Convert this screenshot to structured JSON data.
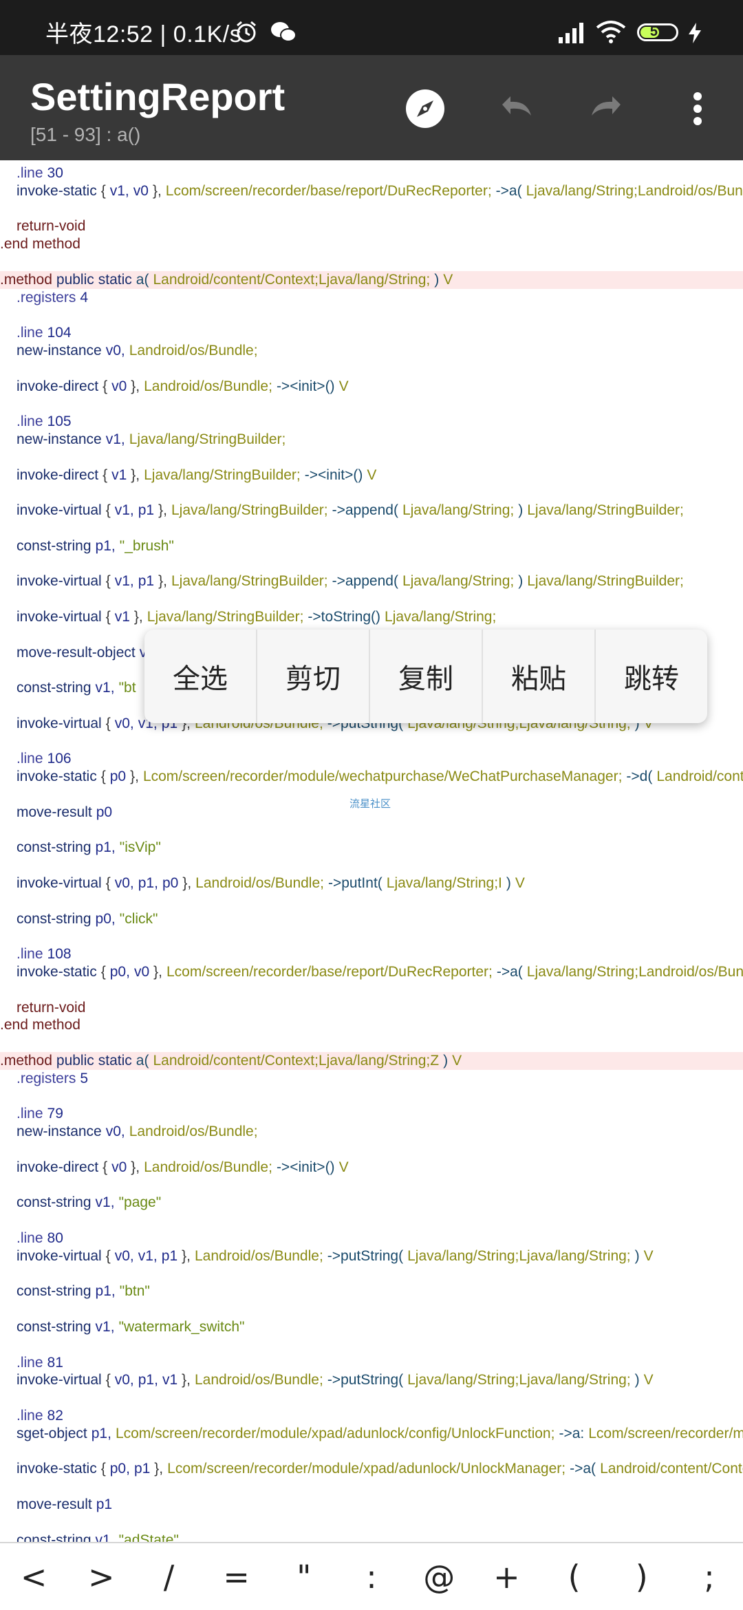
{
  "status_bar": {
    "time": "半夜12:52 | 0.1K/s",
    "battery_level": "57",
    "battery_fraction": 0.57,
    "icons": [
      "alarm-icon",
      "wechat-icon",
      "signal-icon",
      "wifi-icon",
      "battery-icon",
      "charging-icon"
    ]
  },
  "app_bar": {
    "title": "SettingReport",
    "subtitle": "[51 - 93] : a()",
    "actions": [
      "compass-icon",
      "undo-icon",
      "redo-icon",
      "more-vert-icon"
    ]
  },
  "code_lines": [
    [
      [
        "c-dir",
        "    .line"
      ],
      [
        "c-num",
        "30"
      ]
    ],
    [
      [
        "c-kw2",
        "    invoke-static"
      ],
      [
        "c-punc",
        "{"
      ],
      [
        "c-reg",
        "v1,"
      ],
      [
        "c-reg",
        "v0"
      ],
      [
        "c-punc",
        "},"
      ],
      [
        "c-type",
        "Lcom/screen/recorder/base/report/DuRecReporter;"
      ],
      [
        "c-meth",
        "->a("
      ],
      [
        "c-type",
        "Ljava/lang/String;Landroid/os/Bundle;"
      ]
    ],
    [],
    [
      [
        "c-kw",
        "    return-void"
      ]
    ],
    [
      [
        "c-kw",
        ".end"
      ],
      [
        "c-kw",
        "method"
      ]
    ],
    [],
    [
      [
        "c-kw",
        ".method"
      ],
      [
        "c-kw2",
        "public"
      ],
      [
        "c-kw2",
        "static"
      ],
      [
        "c-meth",
        "a("
      ],
      [
        "c-type",
        "Landroid/content/Context;Ljava/lang/String;"
      ],
      [
        "c-meth",
        ")"
      ],
      [
        "c-type",
        "V"
      ]
    ],
    [
      [
        "c-dir",
        "    .registers"
      ],
      [
        "c-num",
        "4"
      ]
    ],
    [],
    [
      [
        "c-dir",
        "    .line"
      ],
      [
        "c-num",
        "104"
      ]
    ],
    [
      [
        "c-kw2",
        "    new-instance"
      ],
      [
        "c-reg",
        "v0,"
      ],
      [
        "c-type",
        "Landroid/os/Bundle;"
      ]
    ],
    [],
    [
      [
        "c-kw2",
        "    invoke-direct"
      ],
      [
        "c-punc",
        "{"
      ],
      [
        "c-reg",
        "v0"
      ],
      [
        "c-punc",
        "},"
      ],
      [
        "c-type",
        "Landroid/os/Bundle;"
      ],
      [
        "c-meth",
        "-><init>()"
      ],
      [
        "c-type",
        "V"
      ]
    ],
    [],
    [
      [
        "c-dir",
        "    .line"
      ],
      [
        "c-num",
        "105"
      ]
    ],
    [
      [
        "c-kw2",
        "    new-instance"
      ],
      [
        "c-reg",
        "v1,"
      ],
      [
        "c-type",
        "Ljava/lang/StringBuilder;"
      ]
    ],
    [],
    [
      [
        "c-kw2",
        "    invoke-direct"
      ],
      [
        "c-punc",
        "{"
      ],
      [
        "c-reg",
        "v1"
      ],
      [
        "c-punc",
        "},"
      ],
      [
        "c-type",
        "Ljava/lang/StringBuilder;"
      ],
      [
        "c-meth",
        "-><init>()"
      ],
      [
        "c-type",
        "V"
      ]
    ],
    [],
    [
      [
        "c-kw2",
        "    invoke-virtual"
      ],
      [
        "c-punc",
        "{"
      ],
      [
        "c-reg",
        "v1,"
      ],
      [
        "c-reg",
        "p1"
      ],
      [
        "c-punc",
        "},"
      ],
      [
        "c-type",
        "Ljava/lang/StringBuilder;"
      ],
      [
        "c-meth",
        "->append("
      ],
      [
        "c-type",
        "Ljava/lang/String;"
      ],
      [
        "c-meth",
        ")"
      ],
      [
        "c-type",
        "Ljava/lang/StringBuilder;"
      ]
    ],
    [],
    [
      [
        "c-kw2",
        "    const-string"
      ],
      [
        "c-reg",
        "p1,"
      ],
      [
        "c-str",
        "\"_brush\""
      ]
    ],
    [],
    [
      [
        "c-kw2",
        "    invoke-virtual"
      ],
      [
        "c-punc",
        "{"
      ],
      [
        "c-reg",
        "v1,"
      ],
      [
        "c-reg",
        "p1"
      ],
      [
        "c-punc",
        "},"
      ],
      [
        "c-type",
        "Ljava/lang/StringBuilder;"
      ],
      [
        "c-meth",
        "->append("
      ],
      [
        "c-type",
        "Ljava/lang/String;"
      ],
      [
        "c-meth",
        ")"
      ],
      [
        "c-type",
        "Ljava/lang/StringBuilder;"
      ]
    ],
    [],
    [
      [
        "c-kw2",
        "    invoke-virtual"
      ],
      [
        "c-punc",
        "{"
      ],
      [
        "c-reg",
        "v1"
      ],
      [
        "c-punc",
        "},"
      ],
      [
        "c-type",
        "Ljava/lang/StringBuilder;"
      ],
      [
        "c-meth",
        "->toString()"
      ],
      [
        "c-type",
        "Ljava/lang/String;"
      ]
    ],
    [],
    [
      [
        "c-kw2",
        "    move-result-object"
      ],
      [
        "c-reg",
        "v1"
      ]
    ],
    [],
    [
      [
        "c-kw2",
        "    const-string"
      ],
      [
        "c-reg",
        "v1,"
      ],
      [
        "c-str",
        "\"bt"
      ]
    ],
    [],
    [
      [
        "c-kw2",
        "    invoke-virtual"
      ],
      [
        "c-punc",
        "{"
      ],
      [
        "c-reg",
        "v0,"
      ],
      [
        "c-reg",
        "v1,"
      ],
      [
        "c-reg",
        "p1"
      ],
      [
        "c-punc",
        "},"
      ],
      [
        "c-type",
        "Landroid/os/Bundle;"
      ],
      [
        "c-meth",
        "->putString("
      ],
      [
        "c-type",
        "Ljava/lang/String;Ljava/lang/String;"
      ],
      [
        "c-meth",
        ")"
      ],
      [
        "c-type",
        "V"
      ]
    ],
    [],
    [
      [
        "c-dir",
        "    .line"
      ],
      [
        "c-num",
        "106"
      ]
    ],
    [
      [
        "c-kw2",
        "    invoke-static"
      ],
      [
        "c-punc",
        "{"
      ],
      [
        "c-reg",
        "p0"
      ],
      [
        "c-punc",
        "},"
      ],
      [
        "c-type",
        "Lcom/screen/recorder/module/wechatpurchase/WeChatPurchaseManager;"
      ],
      [
        "c-meth",
        "->d("
      ],
      [
        "c-type",
        "Landroid/content/Context;"
      ]
    ],
    [],
    [
      [
        "c-kw2",
        "    move-result"
      ],
      [
        "c-reg",
        "p0"
      ]
    ],
    [],
    [
      [
        "c-kw2",
        "    const-string"
      ],
      [
        "c-reg",
        "p1,"
      ],
      [
        "c-str",
        "\"isVip\""
      ]
    ],
    [],
    [
      [
        "c-kw2",
        "    invoke-virtual"
      ],
      [
        "c-punc",
        "{"
      ],
      [
        "c-reg",
        "v0,"
      ],
      [
        "c-reg",
        "p1,"
      ],
      [
        "c-reg",
        "p0"
      ],
      [
        "c-punc",
        "},"
      ],
      [
        "c-type",
        "Landroid/os/Bundle;"
      ],
      [
        "c-meth",
        "->putInt("
      ],
      [
        "c-type",
        "Ljava/lang/String;I"
      ],
      [
        "c-meth",
        ")"
      ],
      [
        "c-type",
        "V"
      ]
    ],
    [],
    [
      [
        "c-kw2",
        "    const-string"
      ],
      [
        "c-reg",
        "p0,"
      ],
      [
        "c-str",
        "\"click\""
      ]
    ],
    [],
    [
      [
        "c-dir",
        "    .line"
      ],
      [
        "c-num",
        "108"
      ]
    ],
    [
      [
        "c-kw2",
        "    invoke-static"
      ],
      [
        "c-punc",
        "{"
      ],
      [
        "c-reg",
        "p0,"
      ],
      [
        "c-reg",
        "v0"
      ],
      [
        "c-punc",
        "},"
      ],
      [
        "c-type",
        "Lcom/screen/recorder/base/report/DuRecReporter;"
      ],
      [
        "c-meth",
        "->a("
      ],
      [
        "c-type",
        "Ljava/lang/String;Landroid/os/Bundle;"
      ]
    ],
    [],
    [
      [
        "c-kw",
        "    return-void"
      ]
    ],
    [
      [
        "c-kw",
        ".end"
      ],
      [
        "c-kw",
        "method"
      ]
    ],
    [],
    [
      [
        "c-kw",
        ".method"
      ],
      [
        "c-kw2",
        "public"
      ],
      [
        "c-kw2",
        "static"
      ],
      [
        "c-meth",
        "a("
      ],
      [
        "c-type",
        "Landroid/content/Context;Ljava/lang/String;Z"
      ],
      [
        "c-meth",
        ")"
      ],
      [
        "c-type",
        "V"
      ]
    ],
    [
      [
        "c-dir",
        "    .registers"
      ],
      [
        "c-num",
        "5"
      ]
    ],
    [],
    [
      [
        "c-dir",
        "    .line"
      ],
      [
        "c-num",
        "79"
      ]
    ],
    [
      [
        "c-kw2",
        "    new-instance"
      ],
      [
        "c-reg",
        "v0,"
      ],
      [
        "c-type",
        "Landroid/os/Bundle;"
      ]
    ],
    [],
    [
      [
        "c-kw2",
        "    invoke-direct"
      ],
      [
        "c-punc",
        "{"
      ],
      [
        "c-reg",
        "v0"
      ],
      [
        "c-punc",
        "},"
      ],
      [
        "c-type",
        "Landroid/os/Bundle;"
      ],
      [
        "c-meth",
        "-><init>()"
      ],
      [
        "c-type",
        "V"
      ]
    ],
    [],
    [
      [
        "c-kw2",
        "    const-string"
      ],
      [
        "c-reg",
        "v1,"
      ],
      [
        "c-str",
        "\"page\""
      ]
    ],
    [],
    [
      [
        "c-dir",
        "    .line"
      ],
      [
        "c-num",
        "80"
      ]
    ],
    [
      [
        "c-kw2",
        "    invoke-virtual"
      ],
      [
        "c-punc",
        "{"
      ],
      [
        "c-reg",
        "v0,"
      ],
      [
        "c-reg",
        "v1,"
      ],
      [
        "c-reg",
        "p1"
      ],
      [
        "c-punc",
        "},"
      ],
      [
        "c-type",
        "Landroid/os/Bundle;"
      ],
      [
        "c-meth",
        "->putString("
      ],
      [
        "c-type",
        "Ljava/lang/String;Ljava/lang/String;"
      ],
      [
        "c-meth",
        ")"
      ],
      [
        "c-type",
        "V"
      ]
    ],
    [],
    [
      [
        "c-kw2",
        "    const-string"
      ],
      [
        "c-reg",
        "p1,"
      ],
      [
        "c-str",
        "\"btn\""
      ]
    ],
    [],
    [
      [
        "c-kw2",
        "    const-string"
      ],
      [
        "c-reg",
        "v1,"
      ],
      [
        "c-str",
        "\"watermark_switch\""
      ]
    ],
    [],
    [
      [
        "c-dir",
        "    .line"
      ],
      [
        "c-num",
        "81"
      ]
    ],
    [
      [
        "c-kw2",
        "    invoke-virtual"
      ],
      [
        "c-punc",
        "{"
      ],
      [
        "c-reg",
        "v0,"
      ],
      [
        "c-reg",
        "p1,"
      ],
      [
        "c-reg",
        "v1"
      ],
      [
        "c-punc",
        "},"
      ],
      [
        "c-type",
        "Landroid/os/Bundle;"
      ],
      [
        "c-meth",
        "->putString("
      ],
      [
        "c-type",
        "Ljava/lang/String;Ljava/lang/String;"
      ],
      [
        "c-meth",
        ")"
      ],
      [
        "c-type",
        "V"
      ]
    ],
    [],
    [
      [
        "c-dir",
        "    .line"
      ],
      [
        "c-num",
        "82"
      ]
    ],
    [
      [
        "c-kw2",
        "    sget-object"
      ],
      [
        "c-reg",
        "p1,"
      ],
      [
        "c-type",
        "Lcom/screen/recorder/module/xpad/adunlock/config/UnlockFunction;"
      ],
      [
        "c-meth",
        "->a:"
      ],
      [
        "c-type",
        "Lcom/screen/recorder/module/xpad/adunlock/config/UnlockFunction;"
      ]
    ],
    [],
    [
      [
        "c-kw2",
        "    invoke-static"
      ],
      [
        "c-punc",
        "{"
      ],
      [
        "c-reg",
        "p0,"
      ],
      [
        "c-reg",
        "p1"
      ],
      [
        "c-punc",
        "},"
      ],
      [
        "c-type",
        "Lcom/screen/recorder/module/xpad/adunlock/UnlockManager;"
      ],
      [
        "c-meth",
        "->a("
      ],
      [
        "c-type",
        "Landroid/content/Context;"
      ]
    ],
    [],
    [
      [
        "c-kw2",
        "    move-result"
      ],
      [
        "c-reg",
        "p1"
      ]
    ],
    [],
    [
      [
        "c-kw2",
        "    const-string"
      ],
      [
        "c-reg",
        "v1,"
      ],
      [
        "c-str",
        "\"adState\""
      ]
    ]
  ],
  "watermark": "流星社区",
  "context_menu": {
    "items": [
      "全选",
      "剪切",
      "复制",
      "粘贴",
      "跳转"
    ]
  },
  "symbol_bar": {
    "keys": [
      "<",
      ">",
      "/",
      "=",
      "\"",
      ":",
      "@",
      "+",
      "(",
      ")",
      ";"
    ]
  }
}
